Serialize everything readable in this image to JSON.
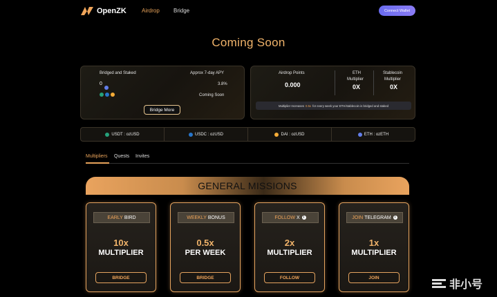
{
  "header": {
    "brand": "OpenZK",
    "nav": [
      "Airdrop",
      "Bridge"
    ],
    "connect_label": "Connect Wallet"
  },
  "page_title": "Coming Soon",
  "bridged": {
    "title": "Bridged and Staked",
    "value": "0",
    "apy_label": "Approx 7-day APY",
    "apy_value": "3.8%",
    "apy_status": "Coming Soon",
    "button": "Bridge More"
  },
  "airdrop": {
    "points_label": "Airdrop Points",
    "points_value": "0.000",
    "eth_label_1": "ETH",
    "eth_label_2": "Multiplier",
    "eth_value": "0X",
    "stable_label_1": "Stablecoin",
    "stable_label_2": "Multiplier",
    "stable_value": "0X",
    "note_pre": "Multiplier Increases",
    "note_hl": "0.5x",
    "note_post": "for every week your ETH/stablecoin is bridged and staked"
  },
  "tokens": [
    {
      "label": "USDT : ozUSD",
      "icon": "usdt-icon",
      "color": "#26a17b"
    },
    {
      "label": "USDC : ozUSD",
      "icon": "usdc-icon",
      "color": "#2775ca"
    },
    {
      "label": "DAI : ozUSD",
      "icon": "dai-icon",
      "color": "#f5ac37"
    },
    {
      "label": "ETH : ozETH",
      "icon": "eth-icon",
      "color": "#627eea"
    }
  ],
  "tabs": [
    "Multipliers",
    "Quests",
    "Invites"
  ],
  "banner": "GENERAL MISSIONS",
  "missions": [
    {
      "label_a": "EARLY",
      "label_b": "BIRD",
      "value": "10x",
      "unit": "MULTIPLIER",
      "button": "BRIDGE"
    },
    {
      "label_a": "WEEKLY",
      "label_b": "BONUS",
      "value": "0.5x",
      "unit": "PER WEEK",
      "button": "BRIDGE"
    },
    {
      "label_a": "FOLLOW",
      "label_b": "X",
      "value": "2x",
      "unit": "MULTIPLIER",
      "button": "FOLLOW"
    },
    {
      "label_a": "JOIN",
      "label_b": "TELEGRAM",
      "value": "1x",
      "unit": "MULTIPLIER",
      "button": "JOIN"
    }
  ],
  "watermark": "非小号",
  "colors": {
    "accent": "#e8a35a",
    "connect": "#6a6cf0"
  }
}
